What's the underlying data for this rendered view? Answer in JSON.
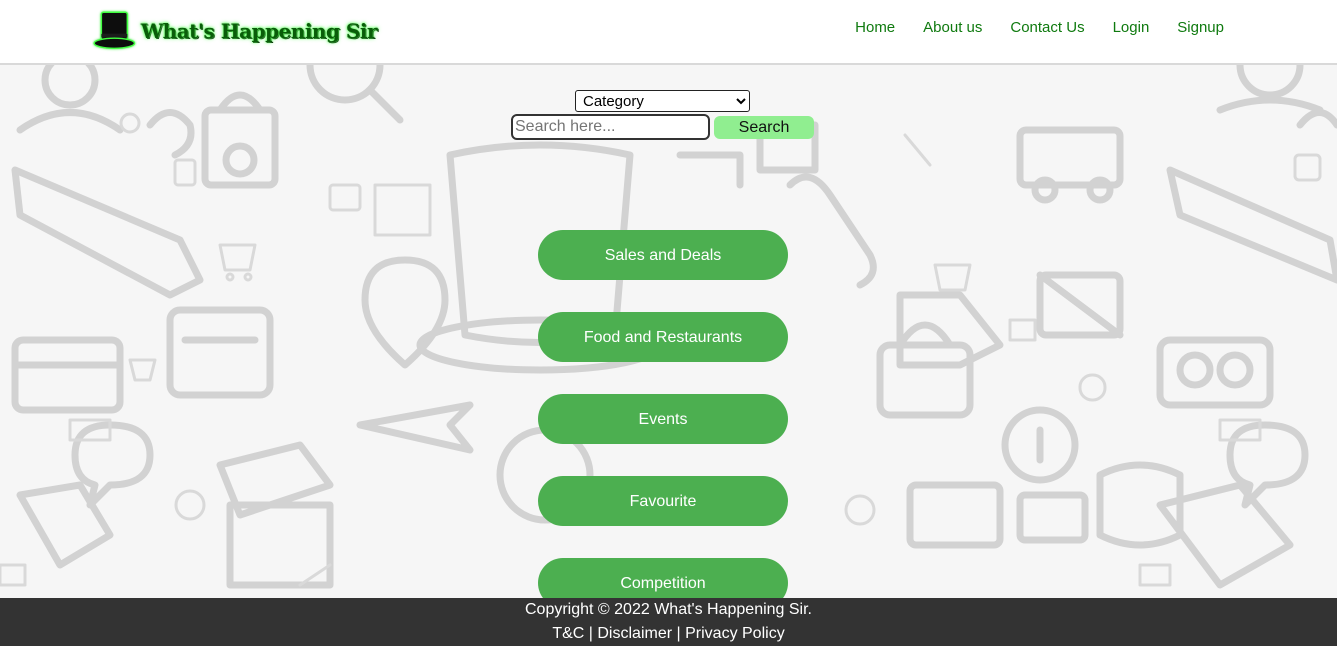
{
  "header": {
    "logo_text": "What's Happening Sir",
    "nav": [
      "Home",
      "About us",
      "Contact Us",
      "Login",
      "Signup"
    ]
  },
  "search": {
    "category_selected": "Category",
    "placeholder": "Search here...",
    "button_label": "Search"
  },
  "categories": [
    "Sales and Deals",
    "Food and Restaurants",
    "Events",
    "Favourite",
    "Competition"
  ],
  "footer": {
    "copyright": "Copyright © 2022 What's Happening Sir.",
    "links": [
      "T&C",
      "Disclaimer",
      "Privacy Policy"
    ],
    "separator": "|"
  },
  "colors": {
    "brand_green": "#4caf50",
    "search_button": "#90ee90",
    "nav_link": "#0f7a0f",
    "footer_bg": "#333333"
  }
}
